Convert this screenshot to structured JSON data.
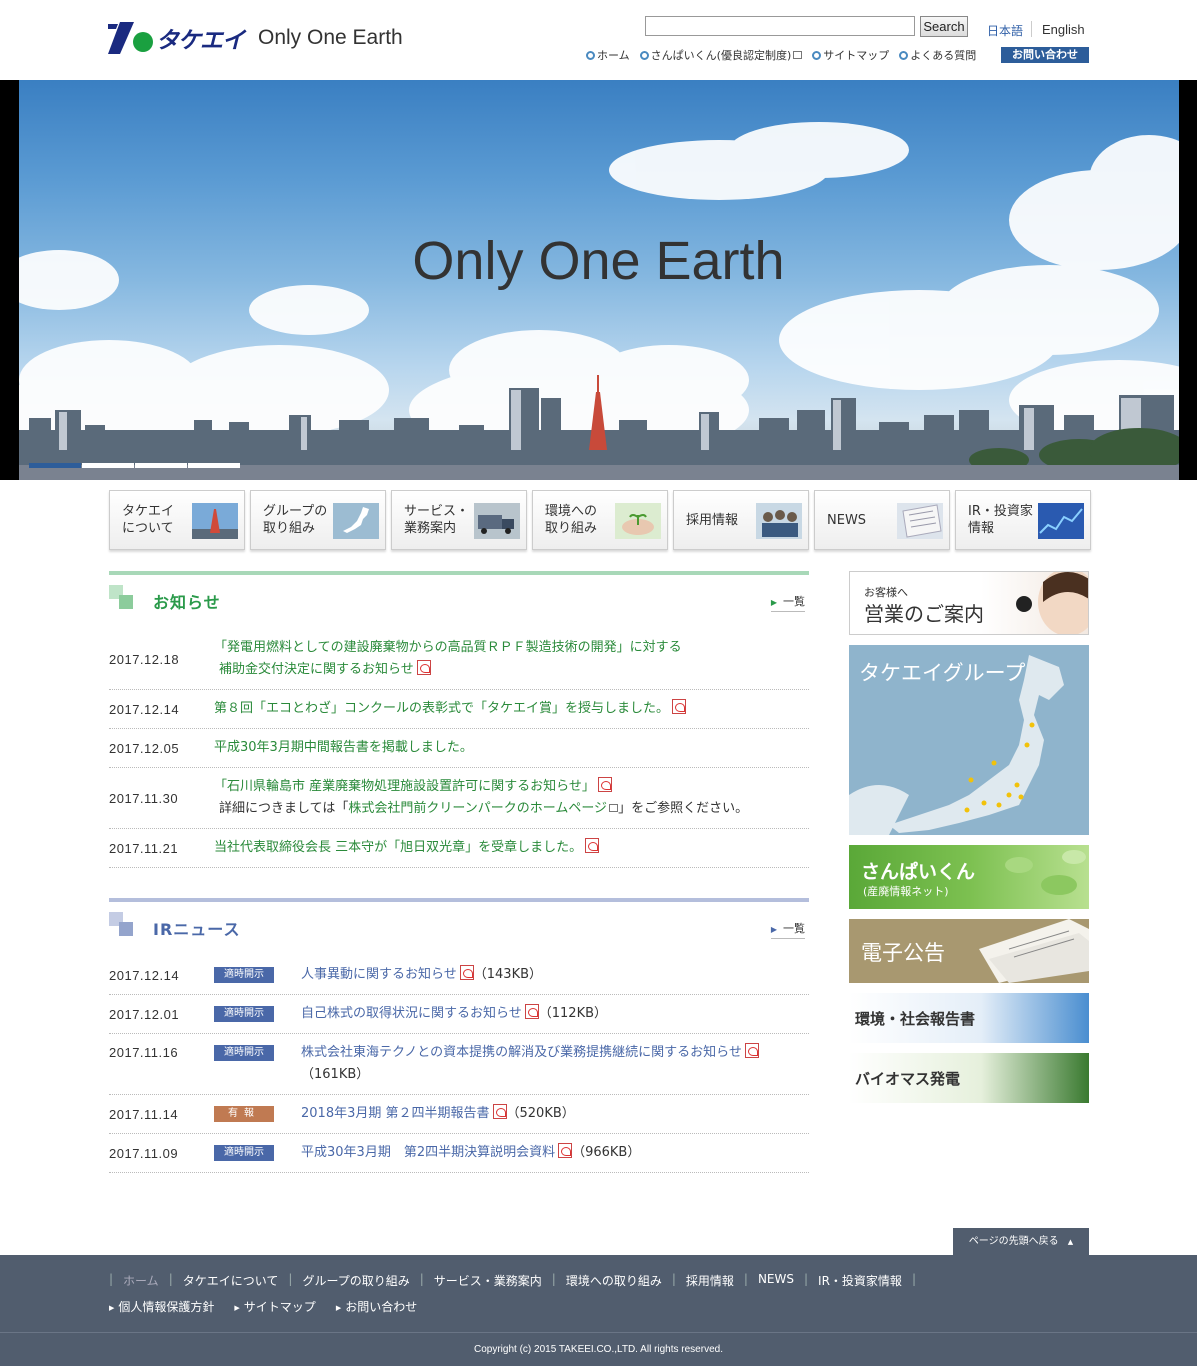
{
  "header": {
    "logo_kana": "タケエイ",
    "logo_tagline": "Only One Earth",
    "search_value": "",
    "search_button": "Search",
    "lang_ja": "日本語",
    "lang_en": "English",
    "util_nav": [
      "ホーム",
      "さんぱいくん(優良認定制度)",
      "サイトマップ",
      "よくある質問"
    ],
    "contact_button": "お問い合わせ"
  },
  "hero": {
    "title": "Only One Earth",
    "slide_count": 4,
    "active_slide": 1
  },
  "global_nav": [
    {
      "label": "タケエイ\nについて",
      "thumb": "tokyo-tower-thumb"
    },
    {
      "label": "グループの\n取り組み",
      "thumb": "japan-map-thumb"
    },
    {
      "label": "サービス・\n業務案内",
      "thumb": "truck-thumb"
    },
    {
      "label": "環境への\n取り組み",
      "thumb": "hands-sprout-thumb"
    },
    {
      "label": "採用情報",
      "thumb": "people-thumb"
    },
    {
      "label": "NEWS",
      "thumb": "newspaper-thumb"
    },
    {
      "label": "IR・投資家\n情報",
      "thumb": "chart-thumb"
    }
  ],
  "news": {
    "title": "お知らせ",
    "more": "一覧",
    "items": [
      {
        "date": "2017.12.18",
        "line1": "「発電用燃料としての建設廃棄物からの高品質ＲＰＦ製造技術の開発」に対する",
        "line2": "補助金交付決定に関するお知らせ"
      },
      {
        "date": "2017.12.14",
        "line1": "第８回「エコとわざ」コンクールの表彰式で「タケエイ賞」を授与しました。"
      },
      {
        "date": "2017.12.05",
        "line1": "平成30年3月期中間報告書を掲載しました。"
      },
      {
        "date": "2017.11.30",
        "line1": "「石川県輪島市 産業廃棄物処理施設設置許可に関するお知らせ」",
        "line2_pre": "詳細につきましては「",
        "line2_link": "株式会社門前クリーンパークのホームページ",
        "line2_post": "」をご参照ください。"
      },
      {
        "date": "2017.11.21",
        "line1": "当社代表取締役会長 三本守が「旭日双光章」を受章しました。"
      }
    ]
  },
  "ir": {
    "title": "IRニュース",
    "more": "一覧",
    "items": [
      {
        "date": "2017.12.14",
        "badge": "適時開示",
        "text": "人事異動に関するお知らせ",
        "size": "（143KB）"
      },
      {
        "date": "2017.12.01",
        "badge": "適時開示",
        "text": "自己株式の取得状況に関するお知らせ",
        "size": "（112KB）"
      },
      {
        "date": "2017.11.16",
        "badge": "適時開示",
        "text": "株式会社東海テクノとの資本提携の解消及び業務提携継続に関するお知らせ",
        "size": "（161KB）"
      },
      {
        "date": "2017.11.14",
        "badge": "有報",
        "text": "2018年3月期 第２四半期報告書",
        "size": "（520KB）"
      },
      {
        "date": "2017.11.09",
        "badge": "適時開示",
        "text": "平成30年3月期　第2四半期決算説明会資料",
        "size": "（966KB）"
      }
    ]
  },
  "sidebar": {
    "sales_small": "お客様へ",
    "sales_big": "営業のご案内",
    "group": "タケエイグループ",
    "sanpai_1": "さんぱいくん",
    "sanpai_2": "(産廃情報ネット)",
    "koukoku": "電子公告",
    "report": "環境・社会報告書",
    "bio": "バイオマス発電"
  },
  "pagetop": "ページの先頭へ戻る",
  "footer": {
    "nav1": [
      "ホーム",
      "タケエイについて",
      "グループの取り組み",
      "サービス・業務案内",
      "環境への取り組み",
      "採用情報",
      "NEWS",
      "IR・投資家情報"
    ],
    "nav2": [
      "個人情報保護方針",
      "サイトマップ",
      "お問い合わせ"
    ],
    "copyright": "Copyright (c) 2015 TAKEEI.CO.,LTD. All rights reserved."
  },
  "colors": {
    "brand_navy": "#1a2a80",
    "logo_green": "#1aa040",
    "news_green": "#2a9a4a",
    "ir_blue": "#4a68a8",
    "footer_bg": "#515d6e"
  }
}
